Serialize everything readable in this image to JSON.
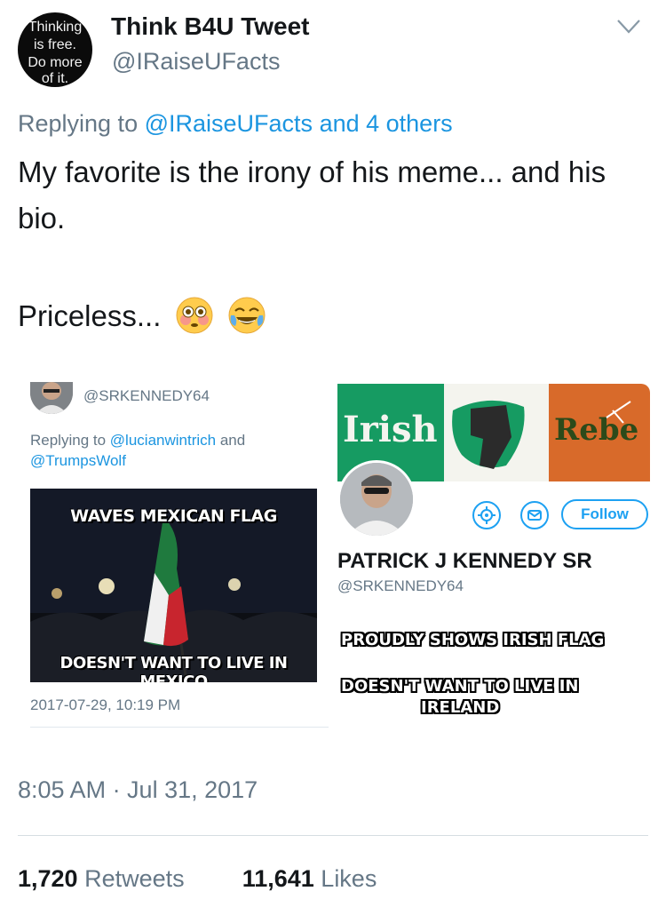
{
  "author": {
    "avatar_lines": [
      "Thinking",
      "is free.",
      "Do more",
      "of it."
    ],
    "display_name": "Think B4U Tweet",
    "handle": "@IRaiseUFacts"
  },
  "reply": {
    "prefix": "Replying to",
    "mention": "@IRaiseUFacts",
    "others": "and 4 others"
  },
  "tweet": {
    "text": "My favorite is the irony of his meme... and his bio.",
    "text2": "Priceless...",
    "emojis": [
      "flushed-face-icon",
      "crying-laughing-face-icon"
    ]
  },
  "embedded_left": {
    "handle": "@SRKENNEDY64",
    "reply_prefix": "Replying to",
    "mention1": "@lucianwintrich",
    "and": "and",
    "mention2": "@TrumpsWolf",
    "meme_top": "WAVES MEXICAN FLAG",
    "meme_bottom": "DOESN'T WANT TO LIVE IN MEXICO",
    "timestamp": "2017-07-29, 10:19 PM"
  },
  "embedded_right": {
    "banner_left": "Irish",
    "banner_right": "Rebe",
    "follow_label": "Follow",
    "name": "PATRICK J KENNEDY SR",
    "handle": "@SRKENNEDY64",
    "caption1": "PROUDLY SHOWS IRISH FLAG",
    "caption2_line1": "DOESN'T WANT TO LIVE IN",
    "caption2_line2": "IRELAND"
  },
  "meta": {
    "timestamp": "8:05 AM · Jul 31, 2017",
    "retweets_count": "1,720",
    "retweets_label": "Retweets",
    "likes_count": "11,641",
    "likes_label": "Likes"
  },
  "colors": {
    "link": "#1b95e0",
    "muted": "#657786",
    "text": "#14171a",
    "irish_green": "#169b62",
    "irish_orange": "#d86a2a"
  }
}
